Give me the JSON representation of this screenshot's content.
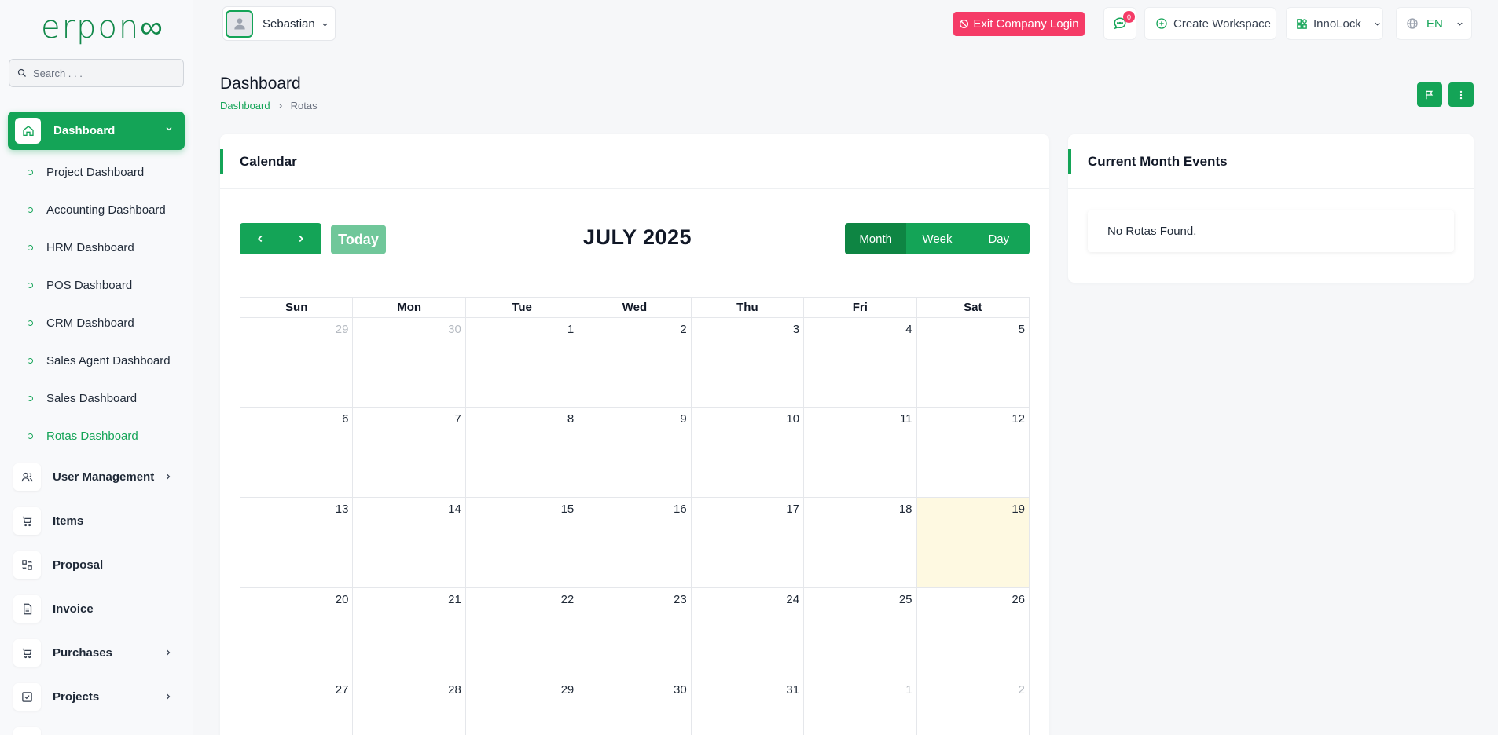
{
  "brand": {
    "logo_text": "erpon∞"
  },
  "search": {
    "placeholder": "Search . . ."
  },
  "sidebar": {
    "active_section": "Dashboard",
    "sub_items": [
      "Project Dashboard",
      "Accounting Dashboard",
      "HRM Dashboard",
      "POS Dashboard",
      "CRM Dashboard",
      "Sales Agent Dashboard",
      "Sales Dashboard",
      "Rotas Dashboard"
    ],
    "active_sub_item": "Rotas Dashboard",
    "nav_items": [
      {
        "label": "User Management",
        "icon": "users-icon",
        "has_children": true
      },
      {
        "label": "Items",
        "icon": "cart-icon",
        "has_children": false
      },
      {
        "label": "Proposal",
        "icon": "swap-icon",
        "has_children": false
      },
      {
        "label": "Invoice",
        "icon": "document-icon",
        "has_children": false
      },
      {
        "label": "Purchases",
        "icon": "cart-icon",
        "has_children": true
      },
      {
        "label": "Projects",
        "icon": "checkbox-icon",
        "has_children": true
      }
    ]
  },
  "header": {
    "user_name": "Sebastian",
    "exit_label": "Exit Company Login",
    "messages_count": "0",
    "create_workspace_label": "Create Workspace",
    "workspace_name": "InnoLock",
    "language": "EN"
  },
  "page": {
    "title": "Dashboard",
    "breadcrumb": [
      "Dashboard",
      "Rotas"
    ]
  },
  "calendar": {
    "card_title": "Calendar",
    "today_label": "Today",
    "month_title": "JULY 2025",
    "views": [
      "Month",
      "Week",
      "Day"
    ],
    "active_view": "Month",
    "weekdays": [
      "Sun",
      "Mon",
      "Tue",
      "Wed",
      "Thu",
      "Fri",
      "Sat"
    ],
    "weeks": [
      [
        "29",
        "30",
        "1",
        "2",
        "3",
        "4",
        "5"
      ],
      [
        "6",
        "7",
        "8",
        "9",
        "10",
        "11",
        "12"
      ],
      [
        "13",
        "14",
        "15",
        "16",
        "17",
        "18",
        "19"
      ],
      [
        "20",
        "21",
        "22",
        "23",
        "24",
        "25",
        "26"
      ],
      [
        "27",
        "28",
        "29",
        "30",
        "31",
        "1",
        "2"
      ]
    ],
    "today_date": "19"
  },
  "events": {
    "card_title": "Current Month Events",
    "empty_text": "No Rotas Found."
  },
  "colors": {
    "primary": "#14a457",
    "danger": "#f53b67",
    "today_highlight": "#fef9e1"
  }
}
